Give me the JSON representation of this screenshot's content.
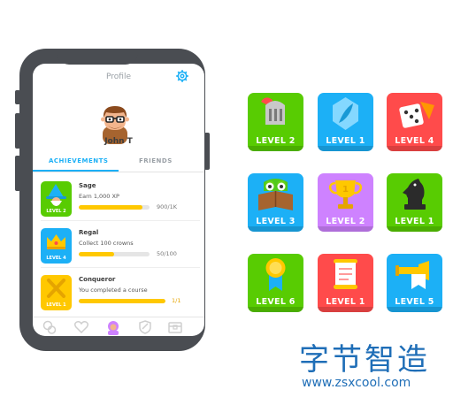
{
  "screen": {
    "title": "Profile",
    "user_name": "John T",
    "tabs": [
      {
        "label": "ACHIEVEMENTS",
        "active": true
      },
      {
        "label": "FRIENDS",
        "active": false
      }
    ],
    "achievements": [
      {
        "title": "Sage",
        "description": "Earn 1,000 XP",
        "progress_text": "900/1K",
        "progress": 0.9,
        "level_label": "LEVEL 2",
        "color": "#58cc02",
        "icon": "wizard-icon"
      },
      {
        "title": "Regal",
        "description": "Collect 100 crowns",
        "progress_text": "50/100",
        "progress": 0.5,
        "level_label": "LEVEL 4",
        "color": "#1cb0f6",
        "icon": "crown-icon"
      },
      {
        "title": "Conqueror",
        "description": "You completed a course",
        "progress_text": "1/1",
        "progress": 1.0,
        "level_label": "LEVEL 1",
        "color": "#ffc800",
        "icon": "swords-icon"
      }
    ],
    "nav_icons": [
      "bubbles-icon",
      "heart-icon",
      "profile-avatar-icon",
      "shield-icon",
      "shop-chest-icon"
    ]
  },
  "badges": [
    {
      "label": "LEVEL 2",
      "color": "#58cc02",
      "icon": "knight-helmet-icon"
    },
    {
      "label": "LEVEL 1",
      "color": "#1cb0f6",
      "icon": "feather-gem-icon"
    },
    {
      "label": "LEVEL 4",
      "color": "#ff4b4b",
      "icon": "dice-icon"
    },
    {
      "label": "LEVEL 3",
      "color": "#1cb0f6",
      "icon": "owl-book-icon"
    },
    {
      "label": "LEVEL 2",
      "color": "#ce82ff",
      "icon": "trophy-icon"
    },
    {
      "label": "LEVEL 1",
      "color": "#58cc02",
      "icon": "chess-knight-icon"
    },
    {
      "label": "LEVEL 6",
      "color": "#58cc02",
      "icon": "medal-icon"
    },
    {
      "label": "LEVEL 1",
      "color": "#ff4b4b",
      "icon": "scroll-icon"
    },
    {
      "label": "LEVEL 5",
      "color": "#1cb0f6",
      "icon": "trumpet-icon"
    }
  ],
  "watermark": {
    "chinese": "字节智造",
    "url": "www.zsxcool.com"
  },
  "colors": {
    "accent": "#1cb0f6",
    "progress": "#ffc800",
    "phone_frame": "#4a4d52"
  }
}
